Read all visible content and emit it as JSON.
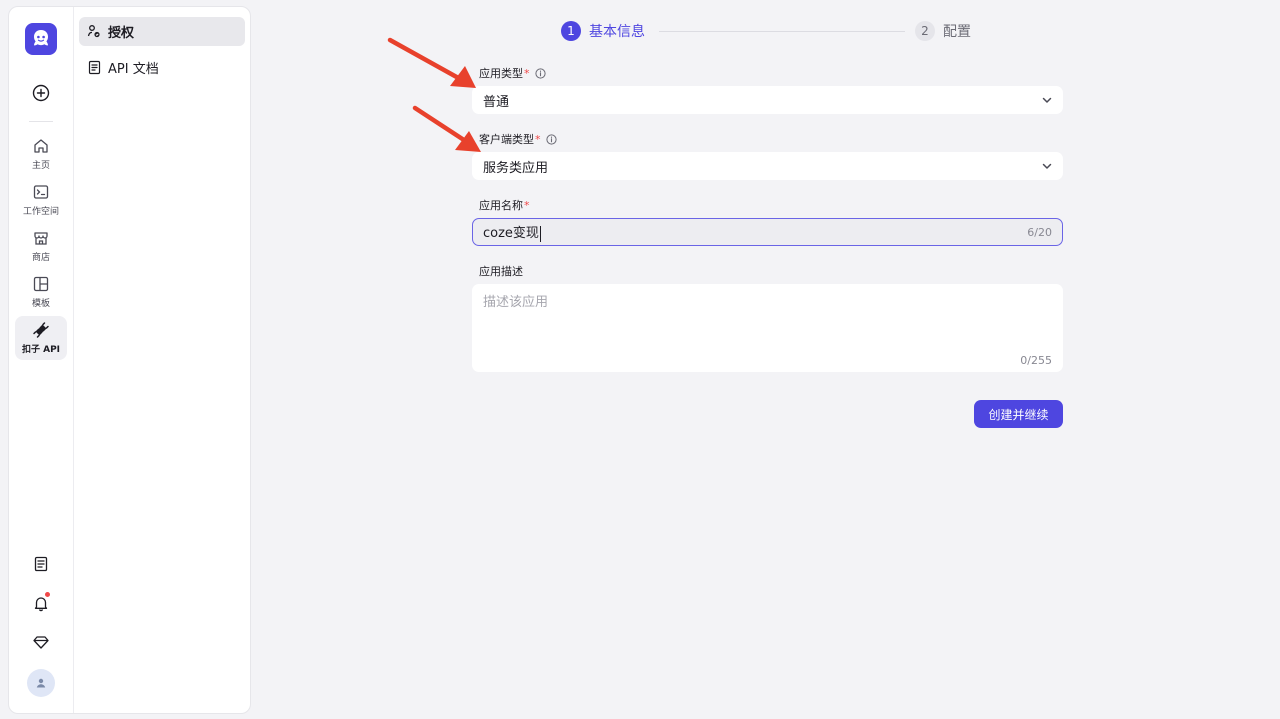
{
  "rail": {
    "items": [
      {
        "label": "主页",
        "icon": "home-icon"
      },
      {
        "label": "工作空间",
        "icon": "terminal-icon"
      },
      {
        "label": "商店",
        "icon": "store-icon"
      },
      {
        "label": "模板",
        "icon": "template-icon"
      },
      {
        "label": "扣子 API",
        "icon": "plug-icon",
        "active": true
      }
    ]
  },
  "subnav": {
    "items": [
      {
        "label": "授权",
        "active": true
      },
      {
        "label": "API 文档"
      }
    ]
  },
  "stepper": {
    "steps": [
      {
        "num": "1",
        "title": "基本信息",
        "active": true
      },
      {
        "num": "2",
        "title": "配置"
      }
    ]
  },
  "form": {
    "app_type": {
      "label": "应用类型",
      "value": "普通"
    },
    "client_type": {
      "label": "客户端类型",
      "value": "服务类应用"
    },
    "app_name": {
      "label": "应用名称",
      "value": "coze变现",
      "count": "6/20"
    },
    "app_desc": {
      "label": "应用描述",
      "placeholder": "描述该应用",
      "count": "0/255"
    },
    "required_mark": "*",
    "submit_label": "创建并继续"
  },
  "colors": {
    "accent": "#4e46e0",
    "annotation_arrow": "#e8412c",
    "badge": "#f04848"
  }
}
